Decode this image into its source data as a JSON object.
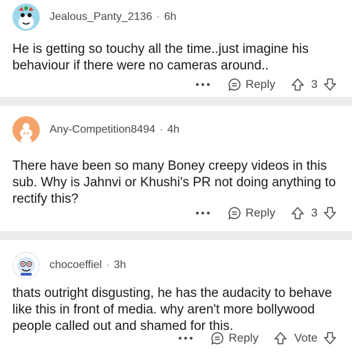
{
  "comments": [
    {
      "username": "Jealous_Panty_2136",
      "time": "6h",
      "body": "He is getting so touchy all the time..just imagine his behaviour if there were no cameras around..",
      "reply_label": "Reply",
      "vote_label": "3"
    },
    {
      "username": "Any-Competition8494",
      "time": "4h",
      "body": "There have been so many Boney creepy videos in this sub. Why is Jahnvi or Khushi's PR not doing anything to rectify this?",
      "reply_label": "Reply",
      "vote_label": "3"
    },
    {
      "username": "chocoeffiel",
      "time": "3h",
      "body": "thats outright disgusting, he has the audacity to behave like this in front of media. why aren't more bollywood people called out and shamed for this.",
      "reply_label": "Reply",
      "vote_label": "Vote"
    }
  ],
  "separator": "·",
  "colors": {
    "background": "#ffffff",
    "separator": "#ececec",
    "text": "#1a1a1b",
    "meta": "#4a4a4a",
    "avatar_orange": "#f4a46a"
  },
  "icons": [
    "more-dots-icon",
    "reply-bubble-icon",
    "upvote-arrow-icon",
    "downvote-arrow-icon"
  ]
}
